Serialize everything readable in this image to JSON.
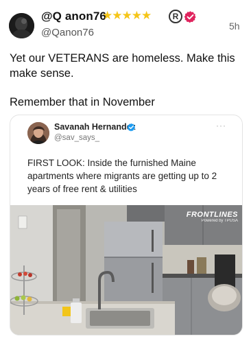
{
  "tweet": {
    "display_name": "@Q anon76",
    "name_stars": "★★★★★",
    "registered_mark": "R",
    "handle": "@Qanon76",
    "time": "5h",
    "text_line1": "Yet our VETERANS are homeless. Make this make sense.",
    "text_line2": "Remember that in November"
  },
  "quote": {
    "name": "Savanah Hernandez",
    "handle": "@sav_says_",
    "more": "···",
    "text": "FIRST LOOK: Inside the furnished Maine apartments where migrants are getting up to 2 years of free rent & utilities",
    "image": {
      "watermark_title": "FRONTLINES",
      "watermark_sub": "Powered by TPUSA"
    }
  },
  "colors": {
    "verified": "#e0245e",
    "quote_verified": "#1d9bf0",
    "stars": "#f5c518"
  }
}
